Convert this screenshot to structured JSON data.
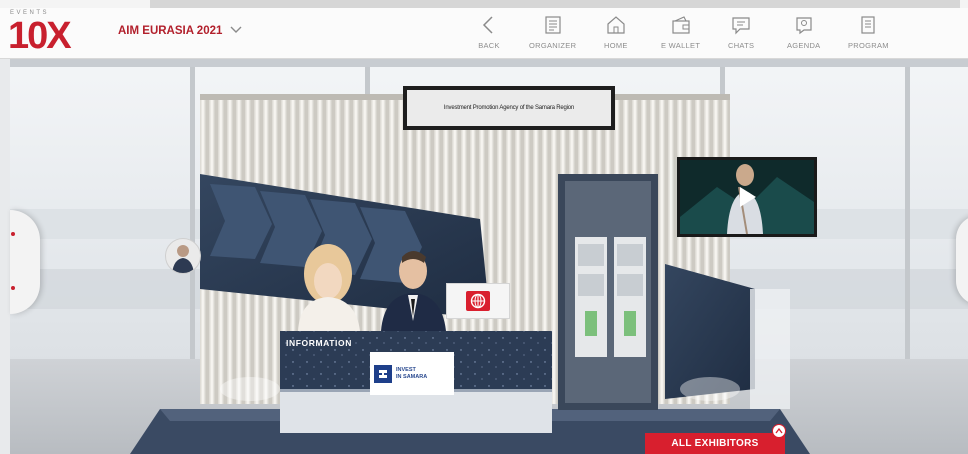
{
  "logo": {
    "events_text": "EVENTS",
    "mark_text": "10X"
  },
  "event_selector": {
    "name": "AIM EURASIA 2021"
  },
  "nav": [
    {
      "id": "back",
      "label": "BACK",
      "icon": "back-chevron-icon"
    },
    {
      "id": "organizer",
      "label": "ORGANIZER",
      "icon": "organizer-icon"
    },
    {
      "id": "home",
      "label": "HOME",
      "icon": "home-icon"
    },
    {
      "id": "ewallet",
      "label": "E WALLET",
      "icon": "wallet-icon"
    },
    {
      "id": "chats",
      "label": "CHATS",
      "icon": "chat-icon"
    },
    {
      "id": "agenda",
      "label": "AGENDA",
      "icon": "agenda-icon"
    },
    {
      "id": "program",
      "label": "PROGRAM",
      "icon": "program-icon"
    }
  ],
  "booth": {
    "banner_text": "Investment Promotion Agency of the Samara Region",
    "desk_label": "INFORMATION",
    "desk_logo_line1": "INVEST",
    "desk_logo_line2": "IN SAMARA"
  },
  "footer": {
    "all_exhibitors_label": "ALL EXHIBITORS"
  },
  "colors": {
    "brand_red": "#c8202e",
    "navy": "#2a3a55",
    "header_bg": "#fbfbfb"
  }
}
